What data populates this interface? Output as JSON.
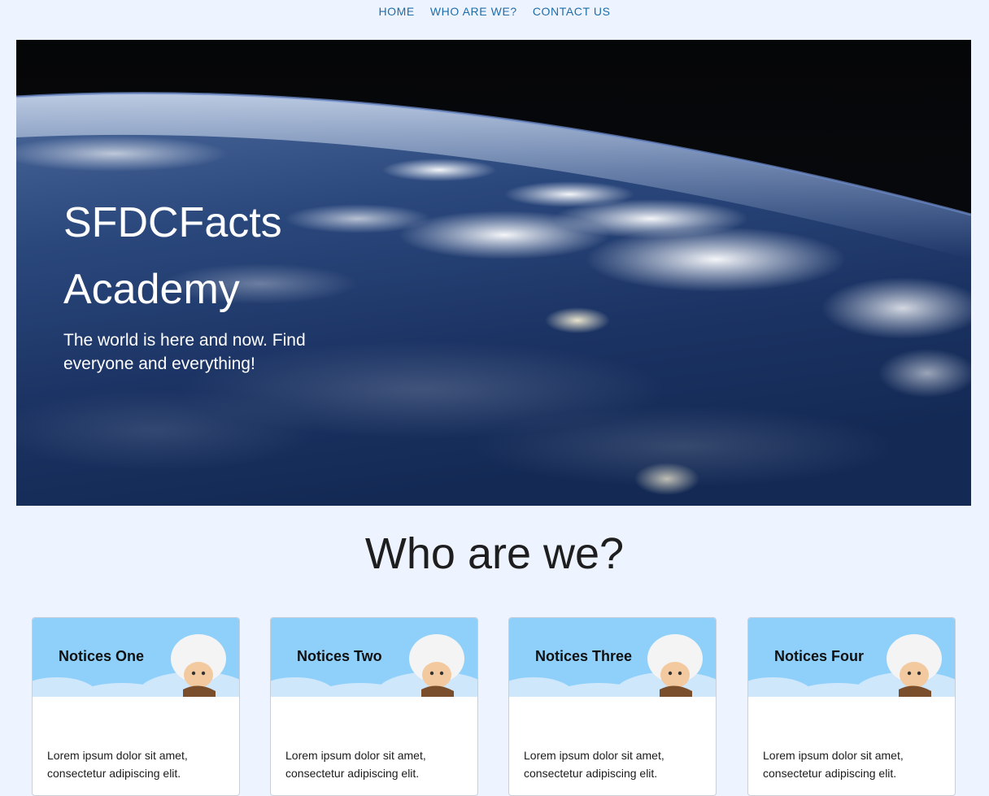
{
  "nav": {
    "items": [
      {
        "label": "HOME"
      },
      {
        "label": "WHO ARE WE?"
      },
      {
        "label": "CONTACT US"
      }
    ]
  },
  "hero": {
    "title": "SFDCFacts Academy",
    "subtitle": "The world is here and now. Find everyone and everything!"
  },
  "section": {
    "title": "Who are we?"
  },
  "cards": [
    {
      "title": "Notices One",
      "body": "Lorem ipsum dolor sit amet, consectetur adipiscing elit."
    },
    {
      "title": "Notices Two",
      "body": "Lorem ipsum dolor sit amet, consectetur adipiscing elit."
    },
    {
      "title": "Notices Three",
      "body": "Lorem ipsum dolor sit amet, consectetur adipiscing elit."
    },
    {
      "title": "Notices Four",
      "body": "Lorem ipsum dolor sit amet, consectetur adipiscing elit."
    }
  ]
}
